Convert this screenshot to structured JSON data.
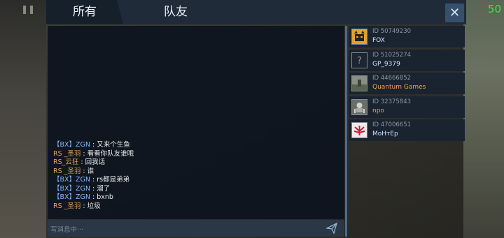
{
  "hud": {
    "fps": "50"
  },
  "tabs": {
    "all_label": "所有",
    "team_label": "队友"
  },
  "close_label": "✕",
  "chat": {
    "lines": [
      {
        "sender": "【BX】ZGN",
        "text": " : 又来个生鱼",
        "team": "bx"
      },
      {
        "sender": "RS _圣羽",
        "text": " : 看看你队友谁哦",
        "team": "rs"
      },
      {
        "sender": "RS_云狂",
        "text": " : 回我话",
        "team": "rs"
      },
      {
        "sender": "RS _圣羽",
        "text": " : 谁",
        "team": "rs"
      },
      {
        "sender": "【BX】ZGN",
        "text": " : rs都是弟弟",
        "team": "bx"
      },
      {
        "sender": "【BX】ZGN",
        "text": " : 溜了",
        "team": "bx"
      },
      {
        "sender": "【BX】ZGN",
        "text": " : bxnb",
        "team": "bx"
      },
      {
        "sender": "RS _圣羽",
        "text": " : 垃圾",
        "team": "rs"
      }
    ],
    "input_placeholder": "写消息中···"
  },
  "players": [
    {
      "id": "ID 50749230",
      "name": "FOX",
      "name_color": "blue",
      "avatar": "fox-avatar-icon"
    },
    {
      "id": "ID 51025274",
      "name": "GP_9379",
      "name_color": "blue",
      "avatar": "unknown-avatar-icon"
    },
    {
      "id": "ID 44666852",
      "name": "Quantum Games",
      "name_color": "orange",
      "avatar": "landscape-avatar-icon"
    },
    {
      "id": "ID 32375843",
      "name": "npo",
      "name_color": "orange",
      "avatar": "robot-avatar-icon"
    },
    {
      "id": "ID 47006651",
      "name": "MoHтEp",
      "name_color": "blue",
      "avatar": "leaf-avatar-icon"
    }
  ],
  "colors": {
    "accent": "#4b6b8f",
    "bx_team": "#7fb6ff",
    "rs_team": "#e3a75a",
    "fps": "#3ee43e"
  }
}
